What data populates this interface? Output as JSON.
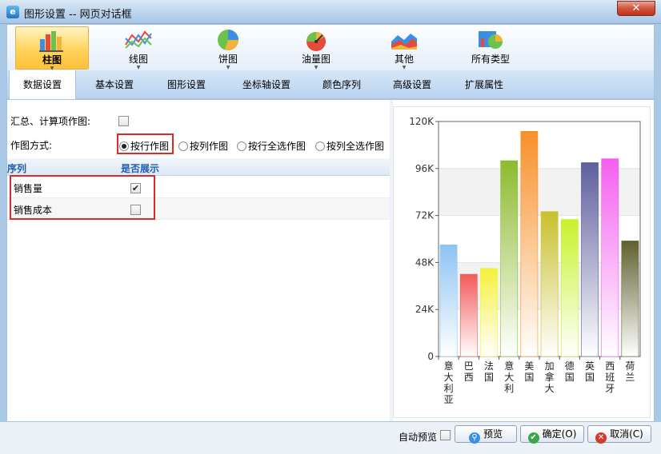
{
  "window": {
    "title": "图形设置 -- 网页对话框",
    "close_glyph": "✕"
  },
  "chart_types": [
    {
      "label": "柱图",
      "icon": "bar-chart-icon",
      "active": true
    },
    {
      "label": "线图",
      "icon": "line-chart-icon",
      "active": false
    },
    {
      "label": "饼图",
      "icon": "pie-chart-icon",
      "active": false
    },
    {
      "label": "油量图",
      "icon": "gauge-chart-icon",
      "active": false
    },
    {
      "label": "其他",
      "icon": "area-chart-icon",
      "active": false
    },
    {
      "label": "所有类型",
      "icon": "all-types-icon",
      "active": false
    }
  ],
  "tabs": [
    "数据设置",
    "基本设置",
    "图形设置",
    "坐标轴设置",
    "颜色序列",
    "高级设置",
    "扩展属性"
  ],
  "active_tab": 0,
  "form": {
    "summary_label": "汇总、计算项作图:",
    "summary_checked": false,
    "mode_label": "作图方式:",
    "modes": [
      "按行作图",
      "按列作图",
      "按行全选作图",
      "按列全选作图"
    ],
    "mode_selected": 0
  },
  "grid": {
    "headers": [
      "序列",
      "是否展示"
    ],
    "rows": [
      {
        "name": "销售量",
        "checked": true
      },
      {
        "name": "销售成本",
        "checked": false
      }
    ]
  },
  "chart_data": {
    "type": "bar",
    "categories": [
      "意大利亚",
      "巴西",
      "法国",
      "意大利",
      "美国",
      "加拿大",
      "德国",
      "英国",
      "西班牙",
      "荷兰"
    ],
    "values": [
      57000,
      42000,
      45000,
      100000,
      115000,
      74000,
      70000,
      99000,
      101000,
      59000
    ],
    "colors": [
      "#8ec3f2",
      "#f25a5a",
      "#f5f03a",
      "#8dbb2e",
      "#f7902a",
      "#c9c02e",
      "#c8f22a",
      "#5e5e9e",
      "#f55ff0",
      "#606030"
    ],
    "ylim": [
      0,
      120000
    ],
    "ytick_labels": [
      "0",
      "24K",
      "48K",
      "72K",
      "96K",
      "120K"
    ],
    "grid": true,
    "legend": "none"
  },
  "footer": {
    "auto_preview_label": "自动预览",
    "preview_label": "预览",
    "ok_label": "确定(O)",
    "cancel_label": "取消(C)"
  }
}
